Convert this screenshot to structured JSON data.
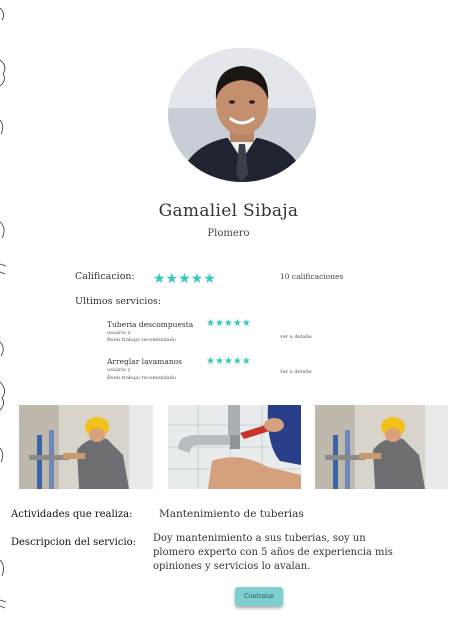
{
  "profile": {
    "name": "Gamaliel Sibaja",
    "role": "Plomero"
  },
  "rating": {
    "label": "Calificacion:",
    "stars": "★★★★★",
    "value": 5,
    "count_text": "10 calificaciones"
  },
  "services": {
    "heading": "Ultimos servicios:",
    "items": [
      {
        "title": "Tuberia descompuesta",
        "user": "usuario x",
        "comment": "Buen trabajo recomendado",
        "stars": "★★★★★",
        "link": "ver a detalle"
      },
      {
        "title": "Arreglar lavamanos",
        "user": "usuario y",
        "comment": "Buen trabajo recomendado",
        "stars": "★★★★★",
        "link": "ver a detalle"
      }
    ]
  },
  "photos": [
    "plumber-working-photo",
    "pipe-repair-photo",
    "plumber-working-photo"
  ],
  "details": {
    "activities_label": "Actividades que realiza:",
    "activities_value": "Mantenimiento de tuberias",
    "description_label": "Descripcion del servicio:",
    "description_value": "Doy mantenimiento a sus tuberias, soy un plomero experto con 5 años de experiencia mis opiniones y servicios lo avalan."
  },
  "actions": {
    "contract_label": "Contratar"
  },
  "colors": {
    "star": "#33c9bb",
    "button": "#7ecfd1"
  }
}
